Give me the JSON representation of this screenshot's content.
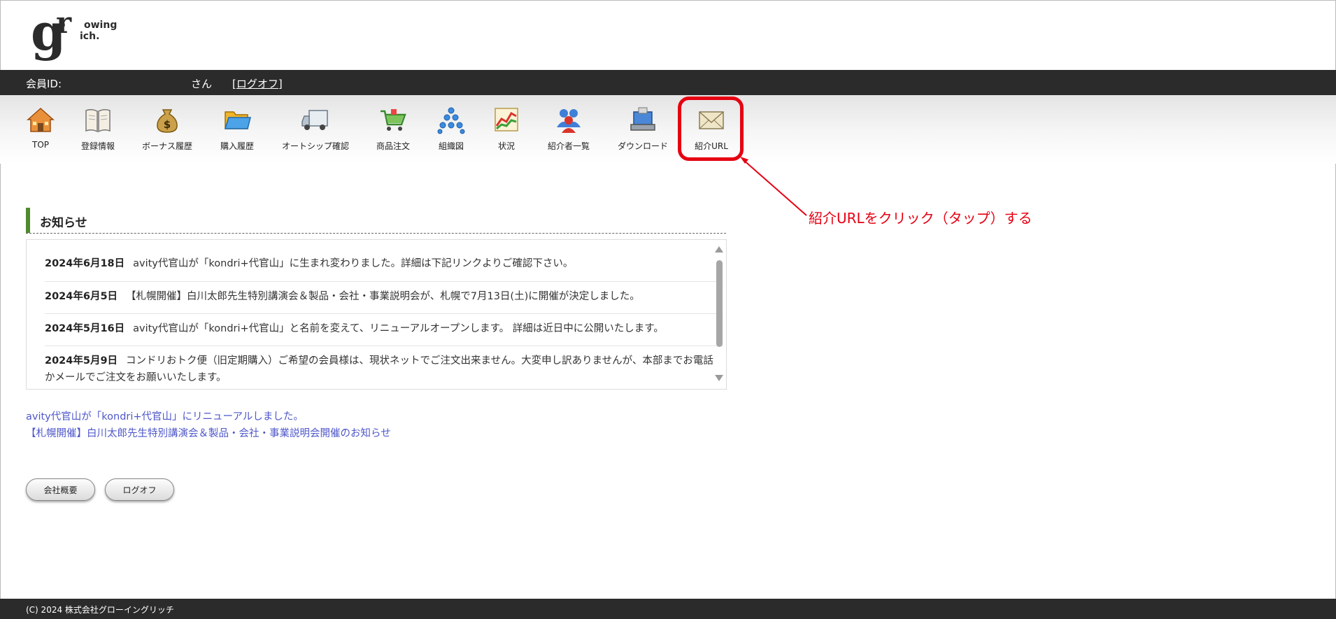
{
  "logo": {
    "mark": "g",
    "mark2": "r",
    "line1": "owing",
    "line2": "ich."
  },
  "member_bar": {
    "id_label": "会員ID:",
    "suffix": "さん",
    "logoff": "[ログオフ]"
  },
  "nav": [
    {
      "label": "TOP",
      "icon": "home-icon"
    },
    {
      "label": "登録情報",
      "icon": "book-icon"
    },
    {
      "label": "ボーナス履歴",
      "icon": "money-bag-icon"
    },
    {
      "label": "購入履歴",
      "icon": "folder-icon"
    },
    {
      "label": "オートシップ確認",
      "icon": "truck-icon"
    },
    {
      "label": "商品注文",
      "icon": "cart-icon"
    },
    {
      "label": "組織図",
      "icon": "org-chart-icon"
    },
    {
      "label": "状況",
      "icon": "chart-icon"
    },
    {
      "label": "紹介者一覧",
      "icon": "users-icon"
    },
    {
      "label": "ダウンロード",
      "icon": "download-icon"
    },
    {
      "label": "紹介URL",
      "icon": "mail-icon"
    }
  ],
  "annotation": "紹介URLをクリック（タップ）する",
  "news": {
    "title": "お知らせ",
    "items": [
      {
        "date": "2024年6月18日",
        "text": "avity代官山が「kondri+代官山」に生まれ変わりました。詳細は下記リンクよりご確認下さい。"
      },
      {
        "date": "2024年6月5日",
        "text": "【札幌開催】白川太郎先生特別講演会＆製品・会社・事業説明会が、札幌で7月13日(土)に開催が決定しました。"
      },
      {
        "date": "2024年5月16日",
        "text": "avity代官山が「kondri+代官山」と名前を変えて、リニューアルオープンします。 詳細は近日中に公開いたします。"
      },
      {
        "date": "2024年5月9日",
        "text": "コンドリおトク便（旧定期購入）ご希望の会員様は、現状ネットでご注文出来ません。大変申し訳ありませんが、本部までお電話かメールでご注文をお願いいたします。"
      }
    ]
  },
  "links": [
    "avity代官山が「kondri+代官山」にリニューアルしました。",
    "【札幌開催】白川太郎先生特別講演会＆製品・会社・事業説明会開催のお知らせ"
  ],
  "buttons": {
    "company": "会社概要",
    "logoff": "ログオフ"
  },
  "footer": "(C) 2024 株式会社グローイングリッチ",
  "colors": {
    "accent_red": "#e60012",
    "header_dark": "#2b2b2b",
    "link_blue": "#4e57c9",
    "title_green": "#4e8b2f"
  }
}
